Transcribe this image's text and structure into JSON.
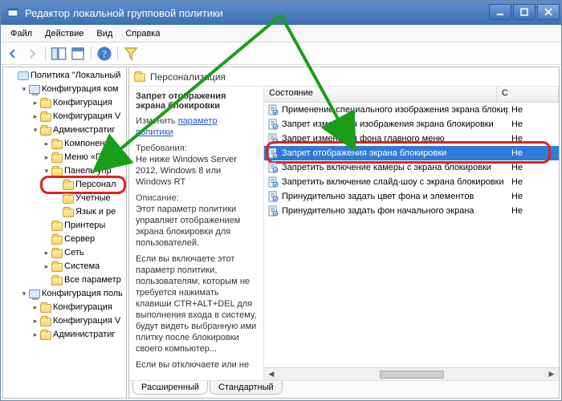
{
  "window": {
    "title": "Редактор локальной групповой политики"
  },
  "menu": {
    "file": "Файл",
    "action": "Действие",
    "view": "Вид",
    "help": "Справка"
  },
  "tree": {
    "root": "Политика \"Локальный",
    "computerConfig": "Конфигурация ком",
    "softwareConfig": "Конфигурация",
    "windowsConfig": "Конфигурация V",
    "adminTemplates": "Администратиг",
    "components": "Компоненть",
    "startMenu": "Меню «Пуск",
    "controlPanel": "Панель упр",
    "personalization": "Персонал",
    "accounts": "Учетные",
    "langRegion": "Язык и ре",
    "printers": "Принтеры",
    "server": "Сервер",
    "network": "Сеть",
    "system": "Система",
    "allSettings": "Все параметр",
    "userConfig": "Конфигурация поль",
    "uSoftware": "Конфигурация",
    "uWindows": "Конфигурация V",
    "uAdmin": "Администратиг"
  },
  "section": {
    "title": "Персонализация"
  },
  "details": {
    "heading": "Запрет отображения экрана блокировки",
    "changeLabel": "Изменить",
    "changeLink": "параметр политики",
    "reqLabel": "Требования:",
    "reqText": "Не ниже Windows Server 2012, Windows 8 или Windows RT",
    "descLabel": "Описание:",
    "descText1": "Этот параметр политики управляет отображением экрана блокировки для пользователей.",
    "descText2": "Если вы включаете этот параметр политики, пользователям, которым не требуется нажимать клавиши CTR+ALT+DEL для выполнения входа в систему, будут видеть выбранную ими плитку после блокировки своего компьютер...",
    "descText3": "Если вы отключаете или не"
  },
  "list": {
    "colState": "Состояние",
    "colC": "С",
    "rows": [
      {
        "name": "Применение специального изображения экрана блокиро",
        "state": "Не"
      },
      {
        "name": "Запрет изменения изображения экрана блокировки",
        "state": "Не"
      },
      {
        "name": "Запрет изменения фона главного меню",
        "state": "Не"
      },
      {
        "name": "Запрет отображения экрана блокировки",
        "state": "Не",
        "selected": true,
        "highlight": true
      },
      {
        "name": "Запретить включение камеры с экрана блокировки",
        "state": "Не"
      },
      {
        "name": "Запретить включение слайд-шоу с экрана блокировки",
        "state": "Не"
      },
      {
        "name": "Принудительно задать цвет фона и элементов",
        "state": "Не"
      },
      {
        "name": "Принудительно задать фон начального экрана",
        "state": "Не"
      }
    ]
  },
  "tabs": {
    "extended": "Расширенный",
    "standard": "Стандартный"
  }
}
